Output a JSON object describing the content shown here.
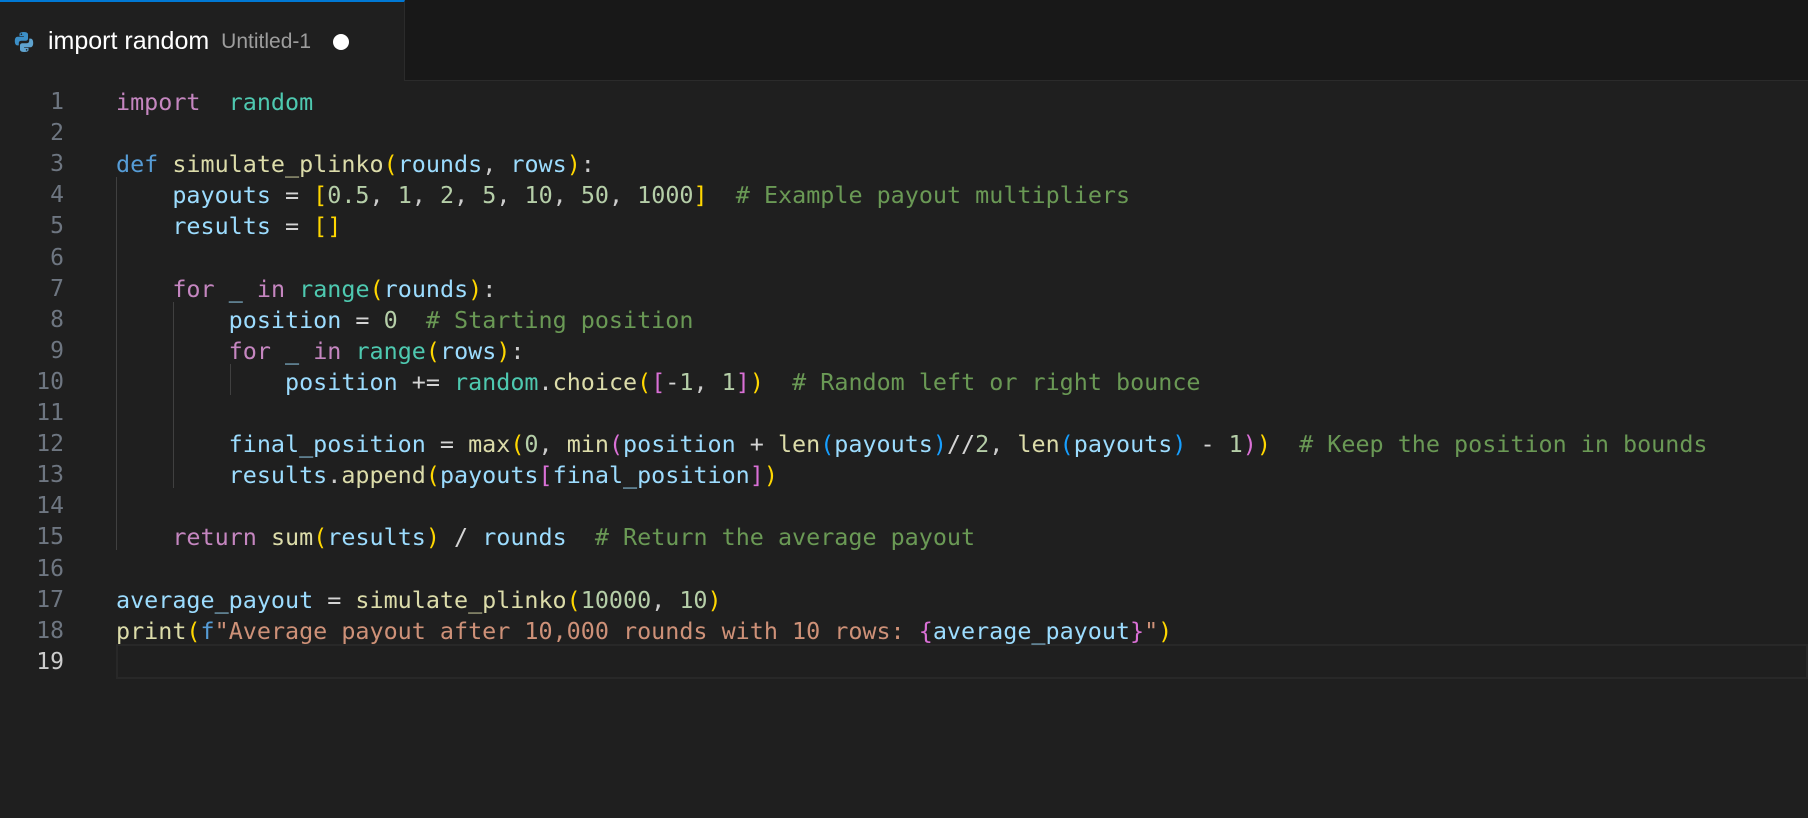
{
  "tab": {
    "icon": "python-file-icon",
    "title": "import random",
    "description": "Untitled-1",
    "dirty_indicator": "unsaved-dot"
  },
  "editor": {
    "active_line": 19,
    "language": "python",
    "theme_colors": {
      "background": "#1f1f1f",
      "keyword": "#c586c0",
      "def_keyword": "#569cd6",
      "function": "#dcdcaa",
      "variable": "#9cdcfe",
      "module": "#4ec9b0",
      "number": "#b5cea8",
      "string": "#ce9178",
      "comment": "#6a9955",
      "bracket_1": "#ffd700",
      "bracket_2": "#da70d6",
      "bracket_3": "#179fff",
      "tab_active_border": "#0078d4"
    },
    "lines": [
      {
        "n": "1",
        "tokens": [
          [
            "kw",
            "import"
          ],
          [
            "",
            "  "
          ],
          [
            "mod",
            "random"
          ]
        ]
      },
      {
        "n": "2",
        "tokens": []
      },
      {
        "n": "3",
        "tokens": [
          [
            "def",
            "def"
          ],
          [
            "",
            " "
          ],
          [
            "fn",
            "simulate_plinko"
          ],
          [
            "b1",
            "("
          ],
          [
            "var",
            "rounds"
          ],
          [
            "",
            ", "
          ],
          [
            "var",
            "rows"
          ],
          [
            "b1",
            ")"
          ],
          [
            "",
            ":"
          ]
        ]
      },
      {
        "n": "4",
        "tokens": [
          [
            "",
            "    "
          ],
          [
            "var",
            "payouts"
          ],
          [
            "op",
            " = "
          ],
          [
            "b1",
            "["
          ],
          [
            "num",
            "0.5"
          ],
          [
            "",
            ", "
          ],
          [
            "num",
            "1"
          ],
          [
            "",
            ", "
          ],
          [
            "num",
            "2"
          ],
          [
            "",
            ", "
          ],
          [
            "num",
            "5"
          ],
          [
            "",
            ", "
          ],
          [
            "num",
            "10"
          ],
          [
            "",
            ", "
          ],
          [
            "num",
            "50"
          ],
          [
            "",
            ", "
          ],
          [
            "num",
            "1000"
          ],
          [
            "b1",
            "]"
          ],
          [
            "",
            "  "
          ],
          [
            "cmt",
            "# Example payout multipliers"
          ]
        ]
      },
      {
        "n": "5",
        "tokens": [
          [
            "",
            "    "
          ],
          [
            "var",
            "results"
          ],
          [
            "op",
            " = "
          ],
          [
            "b1",
            "[]"
          ]
        ]
      },
      {
        "n": "6",
        "tokens": []
      },
      {
        "n": "7",
        "tokens": [
          [
            "",
            "    "
          ],
          [
            "kw",
            "for"
          ],
          [
            "",
            " "
          ],
          [
            "var",
            "_"
          ],
          [
            "",
            " "
          ],
          [
            "kw",
            "in"
          ],
          [
            "",
            " "
          ],
          [
            "mod",
            "range"
          ],
          [
            "b1",
            "("
          ],
          [
            "var",
            "rounds"
          ],
          [
            "b1",
            ")"
          ],
          [
            "",
            ":"
          ]
        ]
      },
      {
        "n": "8",
        "tokens": [
          [
            "",
            "        "
          ],
          [
            "var",
            "position"
          ],
          [
            "op",
            " = "
          ],
          [
            "num",
            "0"
          ],
          [
            "",
            "  "
          ],
          [
            "cmt",
            "# Starting position"
          ]
        ]
      },
      {
        "n": "9",
        "tokens": [
          [
            "",
            "        "
          ],
          [
            "kw",
            "for"
          ],
          [
            "",
            " "
          ],
          [
            "var",
            "_"
          ],
          [
            "",
            " "
          ],
          [
            "kw",
            "in"
          ],
          [
            "",
            " "
          ],
          [
            "mod",
            "range"
          ],
          [
            "b1",
            "("
          ],
          [
            "var",
            "rows"
          ],
          [
            "b1",
            ")"
          ],
          [
            "",
            ":"
          ]
        ]
      },
      {
        "n": "10",
        "tokens": [
          [
            "",
            "            "
          ],
          [
            "var",
            "position"
          ],
          [
            "op",
            " += "
          ],
          [
            "mod",
            "random"
          ],
          [
            "",
            "."
          ],
          [
            "fn",
            "choice"
          ],
          [
            "b1",
            "("
          ],
          [
            "b2",
            "["
          ],
          [
            "op",
            "-"
          ],
          [
            "num",
            "1"
          ],
          [
            "",
            ", "
          ],
          [
            "num",
            "1"
          ],
          [
            "b2",
            "]"
          ],
          [
            "b1",
            ")"
          ],
          [
            "",
            "  "
          ],
          [
            "cmt",
            "# Random left or right bounce"
          ]
        ]
      },
      {
        "n": "11",
        "tokens": []
      },
      {
        "n": "12",
        "tokens": [
          [
            "",
            "        "
          ],
          [
            "var",
            "final_position"
          ],
          [
            "op",
            " = "
          ],
          [
            "fn",
            "max"
          ],
          [
            "b1",
            "("
          ],
          [
            "num",
            "0"
          ],
          [
            "",
            ", "
          ],
          [
            "fn",
            "min"
          ],
          [
            "b2",
            "("
          ],
          [
            "var",
            "position"
          ],
          [
            "op",
            " + "
          ],
          [
            "fn",
            "len"
          ],
          [
            "b3",
            "("
          ],
          [
            "var",
            "payouts"
          ],
          [
            "b3",
            ")"
          ],
          [
            "op",
            "//"
          ],
          [
            "num",
            "2"
          ],
          [
            "",
            ", "
          ],
          [
            "fn",
            "len"
          ],
          [
            "b3",
            "("
          ],
          [
            "var",
            "payouts"
          ],
          [
            "b3",
            ")"
          ],
          [
            "op",
            " - "
          ],
          [
            "num",
            "1"
          ],
          [
            "b2",
            ")"
          ],
          [
            "b1",
            ")"
          ],
          [
            "",
            "  "
          ],
          [
            "cmt",
            "# Keep the position in bounds"
          ]
        ]
      },
      {
        "n": "13",
        "tokens": [
          [
            "",
            "        "
          ],
          [
            "var",
            "results"
          ],
          [
            "",
            "."
          ],
          [
            "fn",
            "append"
          ],
          [
            "b1",
            "("
          ],
          [
            "var",
            "payouts"
          ],
          [
            "b2",
            "["
          ],
          [
            "var",
            "final_position"
          ],
          [
            "b2",
            "]"
          ],
          [
            "b1",
            ")"
          ]
        ]
      },
      {
        "n": "14",
        "tokens": []
      },
      {
        "n": "15",
        "tokens": [
          [
            "",
            "    "
          ],
          [
            "kw",
            "return"
          ],
          [
            "",
            " "
          ],
          [
            "fn",
            "sum"
          ],
          [
            "b1",
            "("
          ],
          [
            "var",
            "results"
          ],
          [
            "b1",
            ")"
          ],
          [
            "op",
            " / "
          ],
          [
            "var",
            "rounds"
          ],
          [
            "",
            "  "
          ],
          [
            "cmt",
            "# Return the average payout"
          ]
        ]
      },
      {
        "n": "16",
        "tokens": []
      },
      {
        "n": "17",
        "tokens": [
          [
            "var",
            "average_payout"
          ],
          [
            "op",
            " = "
          ],
          [
            "fn",
            "simulate_plinko"
          ],
          [
            "b1",
            "("
          ],
          [
            "num",
            "10000"
          ],
          [
            "",
            ", "
          ],
          [
            "num",
            "10"
          ],
          [
            "b1",
            ")"
          ]
        ]
      },
      {
        "n": "18",
        "tokens": [
          [
            "fn",
            "print"
          ],
          [
            "b1",
            "("
          ],
          [
            "def",
            "f"
          ],
          [
            "str",
            "\"Average payout after 10,000 rounds with 10 rows: "
          ],
          [
            "b2",
            "{"
          ],
          [
            "var",
            "average_payout"
          ],
          [
            "b2",
            "}"
          ],
          [
            "str",
            "\""
          ],
          [
            "b1",
            ")"
          ]
        ]
      },
      {
        "n": "19",
        "tokens": []
      }
    ]
  }
}
